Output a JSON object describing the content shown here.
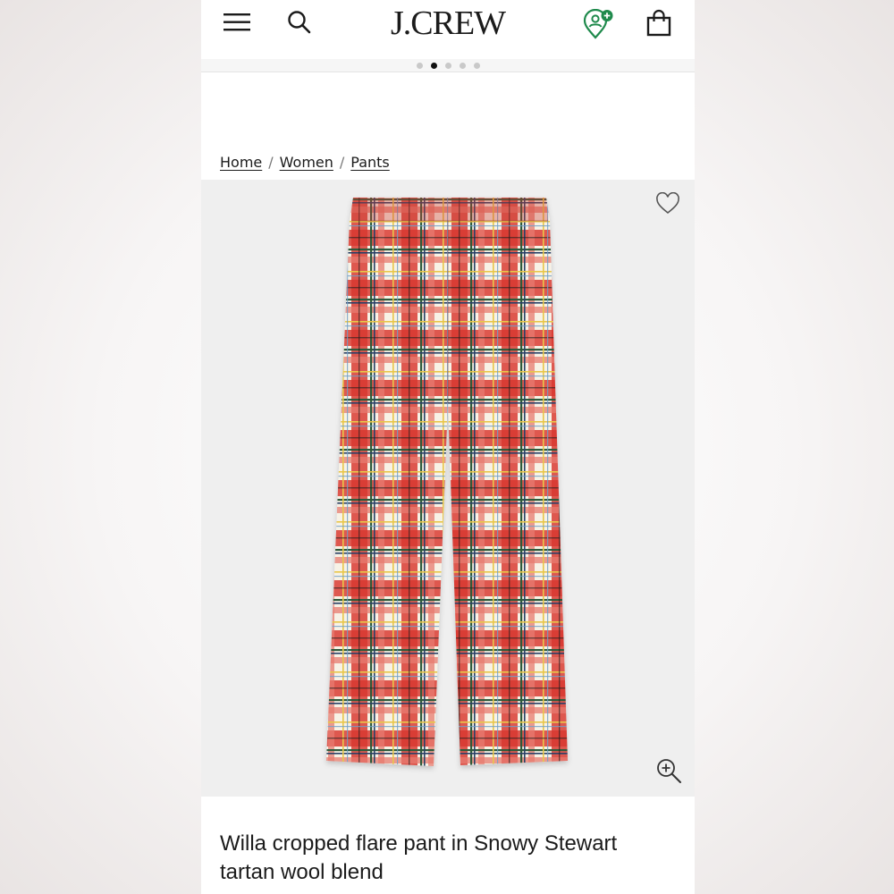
{
  "brand": {
    "name": "J.CREW"
  },
  "header": {
    "icons": [
      "menu-icon",
      "search-icon",
      "rewards-icon",
      "shopping-bag-icon"
    ],
    "rewards_badge_color": "#1f8a4c"
  },
  "carousel": {
    "count": 5,
    "active_index": 1
  },
  "breadcrumb": {
    "items": [
      "Home",
      "Women",
      "Pants"
    ],
    "separator": "/"
  },
  "product": {
    "title": "Willa cropped flare pant in Snowy Stewart tartan wool blend",
    "image_icons": [
      "heart-icon",
      "zoom-in-icon"
    ],
    "colors": {
      "tartan_red": "#d8372f",
      "tartan_cream": "#f7f2e6",
      "tartan_green": "#2f5a3a",
      "tartan_navy": "#2a3f66",
      "tartan_yellow": "#e8c64a"
    }
  }
}
